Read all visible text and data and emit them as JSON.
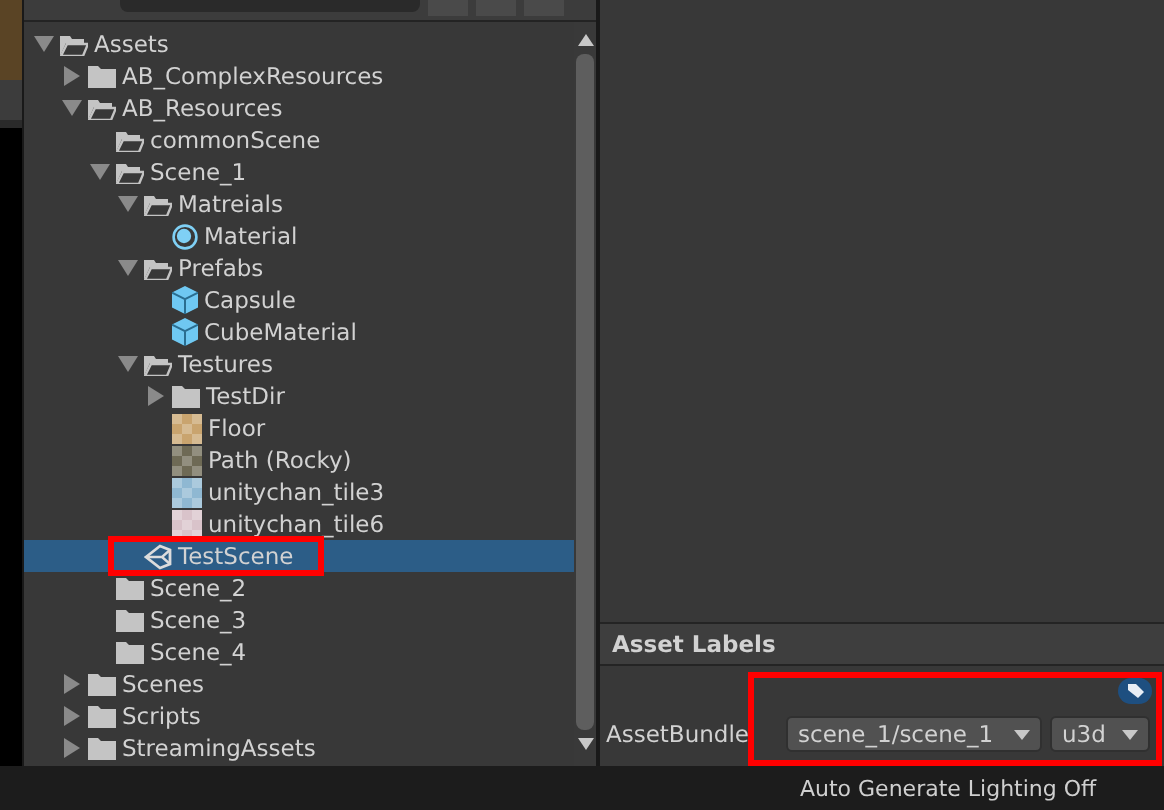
{
  "tree": [
    {
      "label": "Assets",
      "kind": "folder",
      "expanded": true,
      "selected": false,
      "annotated": false,
      "children": [
        {
          "label": "AB_ComplexResources",
          "kind": "folder",
          "expanded": false,
          "selected": false,
          "annotated": false
        },
        {
          "label": "AB_Resources",
          "kind": "folder",
          "expanded": true,
          "selected": false,
          "annotated": false,
          "children": [
            {
              "label": "commonScene",
              "kind": "empty-folder",
              "selected": false,
              "annotated": false
            },
            {
              "label": "Scene_1",
              "kind": "folder",
              "expanded": true,
              "selected": false,
              "annotated": false,
              "children": [
                {
                  "label": "Matreials",
                  "kind": "folder",
                  "expanded": true,
                  "selected": false,
                  "annotated": false,
                  "children": [
                    {
                      "label": "Material",
                      "kind": "material",
                      "selected": false,
                      "annotated": false
                    }
                  ]
                },
                {
                  "label": "Prefabs",
                  "kind": "folder",
                  "expanded": true,
                  "selected": false,
                  "annotated": false,
                  "children": [
                    {
                      "label": "Capsule",
                      "kind": "prefab",
                      "selected": false,
                      "annotated": false
                    },
                    {
                      "label": "CubeMaterial",
                      "kind": "prefab",
                      "selected": false,
                      "annotated": false
                    }
                  ]
                },
                {
                  "label": "Testures",
                  "kind": "folder",
                  "expanded": true,
                  "selected": false,
                  "annotated": false,
                  "children": [
                    {
                      "label": "TestDir",
                      "kind": "folder",
                      "expanded": false,
                      "selected": false,
                      "annotated": false
                    },
                    {
                      "label": "Floor",
                      "kind": "texture",
                      "color": "#c9a46e",
                      "selected": false,
                      "annotated": false
                    },
                    {
                      "label": "Path (Rocky)",
                      "kind": "texture",
                      "color": "#6e6a55",
                      "selected": false,
                      "annotated": false
                    },
                    {
                      "label": "unitychan_tile3",
                      "kind": "texture",
                      "color": "#8fb8d2",
                      "selected": false,
                      "annotated": false
                    },
                    {
                      "label": "unitychan_tile6",
                      "kind": "texture",
                      "color": "#d9c3ca",
                      "selected": false,
                      "annotated": false
                    }
                  ]
                },
                {
                  "label": "TestScene",
                  "kind": "scene",
                  "selected": true,
                  "annotated": true
                }
              ]
            },
            {
              "label": "Scene_2",
              "kind": "folder",
              "selected": false,
              "annotated": false
            },
            {
              "label": "Scene_3",
              "kind": "folder",
              "selected": false,
              "annotated": false
            },
            {
              "label": "Scene_4",
              "kind": "folder",
              "selected": false,
              "annotated": false
            }
          ]
        },
        {
          "label": "Scenes",
          "kind": "folder",
          "expanded": false,
          "selected": false,
          "annotated": false
        },
        {
          "label": "Scripts",
          "kind": "folder",
          "expanded": false,
          "selected": false,
          "annotated": false
        },
        {
          "label": "StreamingAssets",
          "kind": "folder",
          "expanded": false,
          "selected": false,
          "annotated": false
        }
      ]
    }
  ],
  "inspector": {
    "header": "Asset Labels",
    "asset_bundle": {
      "label": "AssetBundle",
      "name": "scene_1/scene_1",
      "variant": "u3d",
      "annotated": true
    }
  },
  "status_bar": "Auto Generate Lighting Off"
}
